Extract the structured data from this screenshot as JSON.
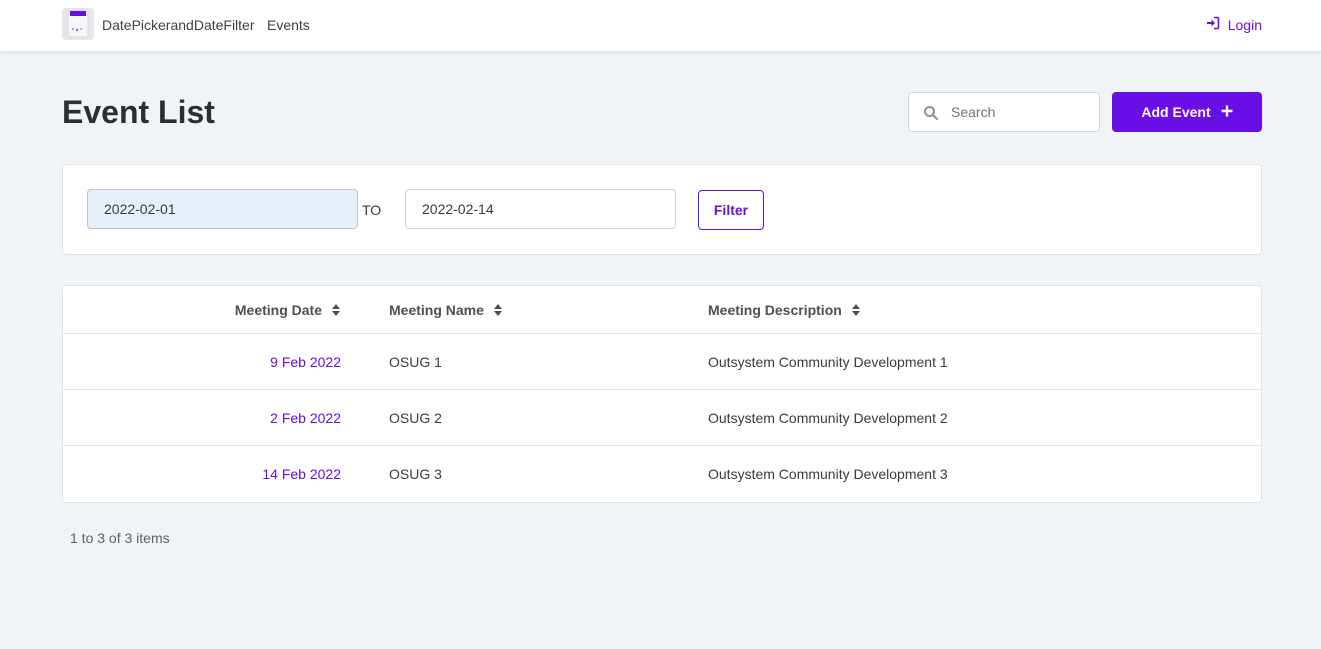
{
  "header": {
    "app_name": "DatePickerandDateFilter",
    "nav_events": "Events",
    "login_label": "Login",
    "logo_icon": "app-logo-icon"
  },
  "page": {
    "title": "Event List"
  },
  "search": {
    "placeholder": "Search",
    "value": ""
  },
  "add_event": {
    "label": "Add Event",
    "icon": "plus-icon"
  },
  "filter": {
    "from_value": "2022-02-01",
    "to_label": "TO",
    "to_value": "2022-02-14",
    "button_label": "Filter"
  },
  "table": {
    "columns": [
      {
        "label": "Meeting Date"
      },
      {
        "label": "Meeting Name"
      },
      {
        "label": "Meeting Description"
      }
    ],
    "rows": [
      {
        "date": "9 Feb 2022",
        "name": "OSUG 1",
        "description": "Outsystem Community Development 1"
      },
      {
        "date": "2 Feb 2022",
        "name": "OSUG 2",
        "description": "Outsystem Community Development 2"
      },
      {
        "date": "14 Feb 2022",
        "name": "OSUG 3",
        "description": "Outsystem Community Development 3"
      }
    ]
  },
  "pagination": {
    "info": "1 to 3 of 3 items"
  },
  "colors": {
    "accent": "#6a0ee6",
    "link": "#6a0eda",
    "background": "#f1f4f7"
  }
}
